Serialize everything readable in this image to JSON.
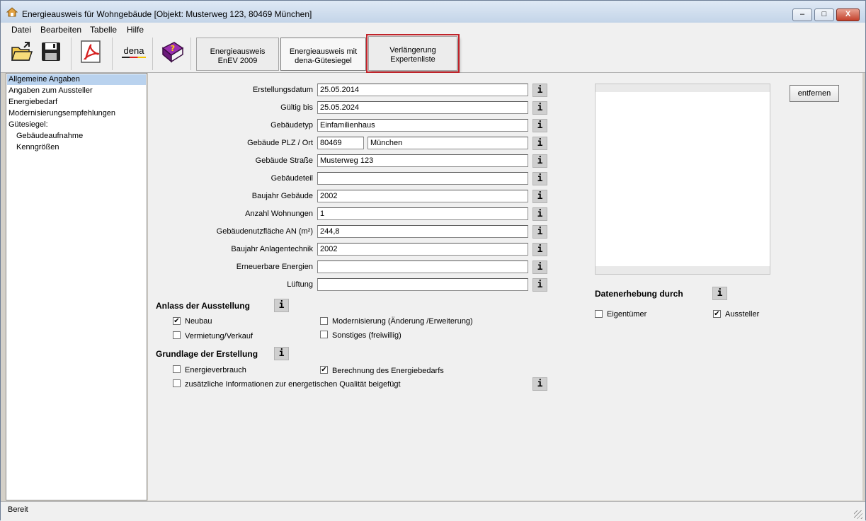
{
  "window": {
    "title": "Energieausweis für Wohngebäude [Objekt: Musterweg 123, 80469 München]",
    "controls": {
      "minimize": "–",
      "maximize": "□",
      "close": "X"
    }
  },
  "menu": [
    "Datei",
    "Bearbeiten",
    "Tabelle",
    "Hilfe"
  ],
  "toolbar": {
    "icons": [
      "open-folder-icon",
      "save-icon",
      "pdf-icon",
      "dena-logo",
      "help-book-icon"
    ],
    "dena_label": "dena",
    "help_glyph": "?",
    "tabs": [
      {
        "line1": "Energieausweis",
        "line2": "EnEV 2009"
      },
      {
        "line1": "Energieausweis mit",
        "line2": "dena-Gütesiegel"
      },
      {
        "line1": "Verlängerung",
        "line2": "Expertenliste"
      }
    ]
  },
  "tree": {
    "items": [
      "Allgemeine Angaben",
      "Angaben zum Aussteller",
      "Energiebedarf",
      "Modernisierungsempfehlungen",
      "Gütesiegel:",
      "Gebäudeaufnahme",
      "Kenngrößen"
    ]
  },
  "form": {
    "fields": [
      {
        "label": "Erstellungsdatum",
        "value": "25.05.2014"
      },
      {
        "label": "Gültig bis",
        "value": "25.05.2024"
      },
      {
        "label": "Gebäudetyp",
        "value": "Einfamilienhaus"
      },
      {
        "label": "Gebäude PLZ / Ort",
        "value": "80469",
        "value2": "München"
      },
      {
        "label": "Gebäude Straße",
        "value": "Musterweg 123"
      },
      {
        "label": "Gebäudeteil",
        "value": ""
      },
      {
        "label": "Baujahr Gebäude",
        "value": "2002"
      },
      {
        "label": "Anzahl Wohnungen",
        "value": "1"
      },
      {
        "label": "Gebäudenutzfläche AN (m²)",
        "value": "244,8"
      },
      {
        "label": "Baujahr Anlagentechnik",
        "value": "2002"
      },
      {
        "label": "Erneuerbare Energien",
        "value": ""
      },
      {
        "label": "Lüftung",
        "value": ""
      }
    ],
    "info_glyph": "i",
    "anlass": {
      "title": "Anlass der Ausstellung",
      "options": [
        {
          "label": "Neubau",
          "checked": true
        },
        {
          "label": "Modernisierung (Änderung /Erweiterung)",
          "checked": false
        },
        {
          "label": "Vermietung/Verkauf",
          "checked": false
        },
        {
          "label": "Sonstiges (freiwillig)",
          "checked": false
        }
      ]
    },
    "grundlage": {
      "title": "Grundlage der Erstellung",
      "options": [
        {
          "label": "Energieverbrauch",
          "checked": false
        },
        {
          "label": "Berechnung des Energiebedarfs",
          "checked": true
        },
        {
          "label": "zusätzliche Informationen zur energetischen Qualität beigefügt",
          "checked": false
        }
      ]
    }
  },
  "right": {
    "remove_button": "entfernen",
    "datenerhebung": {
      "title": "Datenerhebung durch",
      "options": [
        {
          "label": "Eigentümer",
          "checked": false
        },
        {
          "label": "Aussteller",
          "checked": true
        }
      ]
    }
  },
  "status": {
    "text": "Bereit"
  },
  "check_glyph": "✔"
}
